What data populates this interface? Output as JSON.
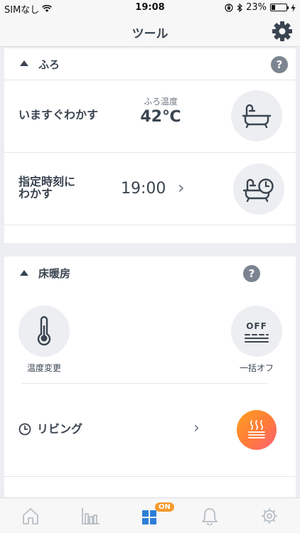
{
  "status_bar": {
    "carrier": "SIMなし",
    "time": "19:08",
    "battery": "23%",
    "battery_level": 0.23
  },
  "header": {
    "title": "ツール"
  },
  "bath": {
    "section_label": "ふろ",
    "help_label": "?",
    "now": {
      "label": "いますぐわかす",
      "temp_caption": "ふろ温度",
      "temp_value": "42℃"
    },
    "scheduled": {
      "label_line1": "指定時刻に",
      "label_line2": "わかす",
      "time": "19:00",
      "chevron": "›"
    }
  },
  "floor_heating": {
    "section_label": "床暖房",
    "help_label": "?",
    "temp_change_label": "温度変更",
    "all_off_label": "一括オフ",
    "off_icon_text": "OFF",
    "room": {
      "label": "リビング",
      "chevron": "›"
    }
  },
  "tab_bar": {
    "on_badge": "ON",
    "items": [
      "home-icon",
      "chart-icon",
      "tools-icon",
      "bell-icon",
      "settings-icon"
    ],
    "active_color": "#2d7fd6"
  }
}
